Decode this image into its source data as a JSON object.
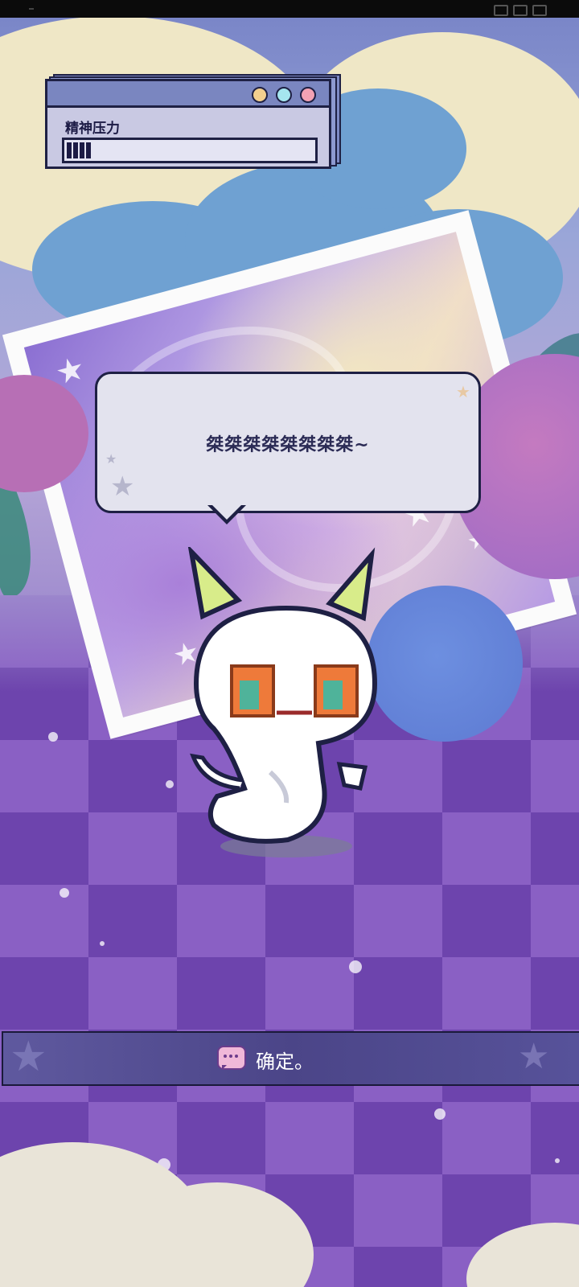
{
  "stress_window": {
    "label": "精神压力",
    "stress_level_fraction": 0.1,
    "dot_colors": [
      "#f2cf8e",
      "#a5e6ef",
      "#f3a2b4"
    ]
  },
  "speech_bubble": {
    "text": "桀桀桀桀桀桀桀桀~"
  },
  "dialog_option": {
    "text": "确定。",
    "icon": "chat-bubble-icon"
  },
  "colors": {
    "frame_outline": "#1e2044",
    "floor_dark": "#6d44ad",
    "floor_light": "#8a60c4",
    "bubble_bg": "#e3e3ee",
    "dialog_bg": "#4b4588"
  }
}
